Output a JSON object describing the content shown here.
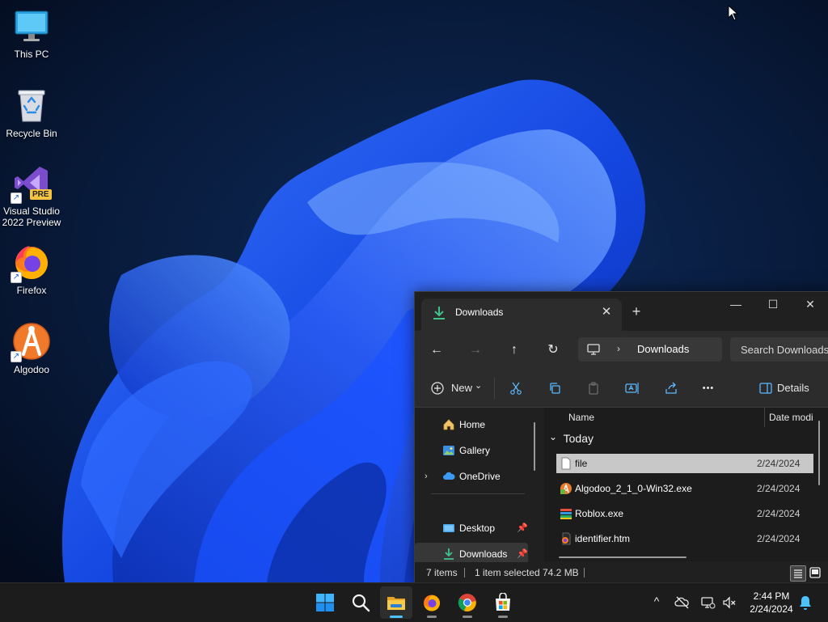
{
  "desktop": {
    "icons": [
      {
        "label": "This PC",
        "icon": "monitor-icon"
      },
      {
        "label": "Recycle Bin",
        "icon": "recycle-bin-icon"
      },
      {
        "label": "Visual Studio 2022 Preview",
        "icon": "visual-studio-icon",
        "badge": "PRE"
      },
      {
        "label": "Firefox",
        "icon": "firefox-icon"
      },
      {
        "label": "Algodoo",
        "icon": "algodoo-icon"
      }
    ]
  },
  "explorer": {
    "tab_title": "Downloads",
    "tab_icon": "download-arrow-icon",
    "new_tab_label": "+",
    "controls": {
      "minimize": "—",
      "maximize": "☐",
      "close": "✕"
    },
    "nav": {
      "back": "←",
      "forward": "→",
      "up": "↑",
      "refresh": "↻"
    },
    "address": {
      "root_icon": "pc-icon",
      "separator": "›",
      "crumb": "Downloads"
    },
    "search": {
      "placeholder": "Search Downloads"
    },
    "commands": {
      "new_label": "New",
      "new_chevron": "⌄",
      "more_label": "•••",
      "details_label": "Details"
    },
    "nav_pane": [
      {
        "label": "Home",
        "icon": "home-icon"
      },
      {
        "label": "Gallery",
        "icon": "gallery-icon"
      },
      {
        "label": "OneDrive",
        "icon": "onedrive-cloud-icon",
        "expand": "›"
      },
      {
        "label": "Desktop",
        "icon": "desktop-folder-icon",
        "pinned": true
      },
      {
        "label": "Downloads",
        "icon": "download-arrow-icon",
        "pinned": true,
        "selected": true
      }
    ],
    "columns": {
      "name": "Name",
      "date": "Date modi"
    },
    "group": {
      "label": "Today",
      "chevron": "⌄"
    },
    "files": [
      {
        "name": "file",
        "date": "2/24/2024",
        "icon": "blank-file-icon",
        "selected": true
      },
      {
        "name": "Algodoo_2_1_0-Win32.exe",
        "date": "2/24/2024",
        "icon": "algodoo-installer-icon"
      },
      {
        "name": "Roblox.exe",
        "date": "2/24/2024",
        "icon": "roblox-installer-icon"
      },
      {
        "name": "identifier.htm",
        "date": "2/24/2024",
        "icon": "html-file-icon"
      }
    ],
    "status": {
      "items": "7 items",
      "selection": "1 item selected",
      "size": "74.2 MB"
    }
  },
  "taskbar": {
    "apps": [
      {
        "name": "start-button",
        "icon": "windows-logo-icon"
      },
      {
        "name": "search-button",
        "icon": "search-icon"
      },
      {
        "name": "file-explorer-button",
        "icon": "folder-icon",
        "active": true
      },
      {
        "name": "firefox-button",
        "icon": "firefox-icon",
        "running": true
      },
      {
        "name": "chrome-button",
        "icon": "chrome-icon",
        "running": true
      },
      {
        "name": "store-button",
        "icon": "microsoft-store-icon",
        "running": true
      }
    ],
    "tray": {
      "chevron": "^",
      "time": "2:44 PM",
      "date": "2/24/2024"
    }
  },
  "colors": {
    "accent": "#4cc2ff",
    "wallpaper_bloom": "#1d4fe6",
    "explorer_bg": "#202020"
  }
}
